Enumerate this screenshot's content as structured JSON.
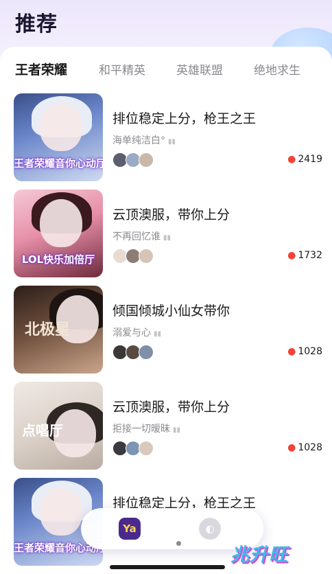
{
  "header": {
    "title": "推荐"
  },
  "tabs": [
    {
      "label": "王者荣耀",
      "active": true
    },
    {
      "label": "和平精英",
      "active": false
    },
    {
      "label": "英雄联盟",
      "active": false
    },
    {
      "label": "绝地求生",
      "active": false
    }
  ],
  "rooms": [
    {
      "title": "排位稳定上分，枪王之王",
      "owner": "海单纯洁白°",
      "heat": "2419",
      "banner": "王者荣耀音你心动厅"
    },
    {
      "title": "云顶澳服，带你上分",
      "owner": "不再回忆谁",
      "heat": "1732",
      "banner": "LOL快乐加倍厅"
    },
    {
      "title": "倾国倾城小仙女带你",
      "owner": "溺爱与心",
      "heat": "1028",
      "banner": "北极星"
    },
    {
      "title": "云顶澳服，带你上分",
      "owner": "拒接一切暧昧",
      "heat": "1028",
      "banner": "点唱厅"
    },
    {
      "title": "排位稳定上分，枪王之王",
      "owner": "",
      "heat": "",
      "banner": "王者荣耀音你心动厅"
    }
  ],
  "dock": {
    "apps": [
      {
        "name": "Ya",
        "icon": "ya-app-icon"
      },
      {
        "name": "",
        "icon": "moon-app-icon"
      }
    ]
  },
  "watermark": {
    "text": "兆升旺"
  },
  "colors": {
    "accent": "#5a2ca8",
    "flame": "#f0443a",
    "watermark": "#3fbbe8"
  }
}
